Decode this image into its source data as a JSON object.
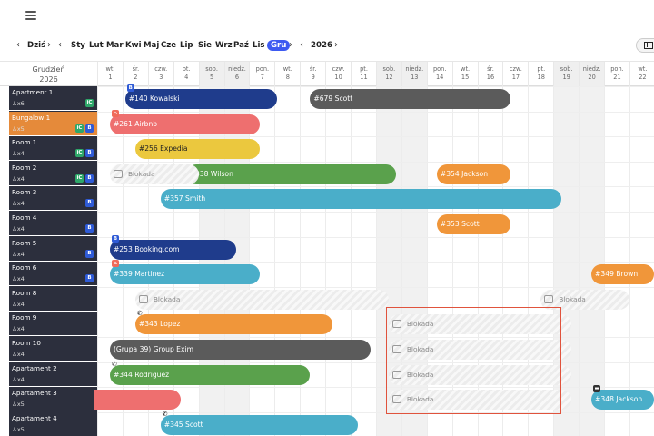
{
  "nav": {
    "today": "Dziś",
    "months": [
      "Sty",
      "Lut",
      "Mar",
      "Kwi",
      "Maj",
      "Cze",
      "Lip",
      "Sie",
      "Wrz",
      "Paź",
      "Lis",
      "Gru"
    ],
    "active_month": "Gru",
    "year": "2026"
  },
  "header": {
    "month_title": "Grudzień",
    "month_year": "2026",
    "days": [
      {
        "dow": "wt.",
        "num": "1"
      },
      {
        "dow": "śr.",
        "num": "2"
      },
      {
        "dow": "czw.",
        "num": "3"
      },
      {
        "dow": "pt.",
        "num": "4"
      },
      {
        "dow": "sob.",
        "num": "5"
      },
      {
        "dow": "niedz.",
        "num": "6"
      },
      {
        "dow": "pon.",
        "num": "7"
      },
      {
        "dow": "wt.",
        "num": "8"
      },
      {
        "dow": "śr.",
        "num": "9"
      },
      {
        "dow": "czw.",
        "num": "10"
      },
      {
        "dow": "pt.",
        "num": "11"
      },
      {
        "dow": "sob.",
        "num": "12"
      },
      {
        "dow": "niedz.",
        "num": "13"
      },
      {
        "dow": "pon.",
        "num": "14"
      },
      {
        "dow": "wt.",
        "num": "15"
      },
      {
        "dow": "śr.",
        "num": "16"
      },
      {
        "dow": "czw.",
        "num": "17"
      },
      {
        "dow": "pt.",
        "num": "18"
      },
      {
        "dow": "sob.",
        "num": "19"
      },
      {
        "dow": "niedz.",
        "num": "20"
      },
      {
        "dow": "pon.",
        "num": "21"
      },
      {
        "dow": "wt.",
        "num": "22"
      }
    ]
  },
  "rooms": [
    {
      "name": "Apartment 1",
      "cap": "x6",
      "badges": [
        "iC"
      ]
    },
    {
      "name": "Bungalow 1",
      "cap": "x5",
      "badges": [
        "iC",
        "B"
      ],
      "active": true
    },
    {
      "name": "Room 1",
      "cap": "x4",
      "badges": [
        "iC",
        "B"
      ]
    },
    {
      "name": "Room 2",
      "cap": "x4",
      "badges": [
        "iC",
        "B"
      ]
    },
    {
      "name": "Room 3",
      "cap": "x4",
      "badges": [
        "B"
      ]
    },
    {
      "name": "Room 4",
      "cap": "x4",
      "badges": [
        "B"
      ]
    },
    {
      "name": "Room 5",
      "cap": "x4",
      "badges": [
        "B"
      ]
    },
    {
      "name": "Room 6",
      "cap": "x4",
      "badges": [
        "B"
      ]
    },
    {
      "name": "Room 8",
      "cap": "x4",
      "badges": []
    },
    {
      "name": "Room 9",
      "cap": "x4",
      "badges": []
    },
    {
      "name": "Room 10",
      "cap": "x4",
      "badges": []
    },
    {
      "name": "Apartament 2",
      "cap": "x4",
      "badges": []
    },
    {
      "name": "Apartament 3",
      "cap": "x5",
      "badges": []
    },
    {
      "name": "Apartament 4",
      "cap": "x5",
      "badges": []
    }
  ],
  "bookings": [
    {
      "label": "#140 Kowalski",
      "color": "#1f3c8c",
      "row": 0
    },
    {
      "label": "#679 Scott",
      "color": "#5b5b5b",
      "row": 0
    },
    {
      "label": "#261 Airbnb",
      "color": "#ee6f6f",
      "row": 1
    },
    {
      "label": "#256 Expedia",
      "color": "#ebc83e",
      "row": 2
    },
    {
      "label": "#338 Wilson",
      "color": "#5aa14c",
      "row": 3
    },
    {
      "label": "#354 Jackson",
      "color": "#f0963a",
      "row": 3
    },
    {
      "label": "#357 Smith",
      "color": "#4aaec9",
      "row": 4
    },
    {
      "label": "#353 Scott",
      "color": "#f0963a",
      "row": 5
    },
    {
      "label": "#253 Booking.com",
      "color": "#1f3c8c",
      "row": 6
    },
    {
      "label": "#339 Martinez",
      "color": "#4aaec9",
      "row": 7
    },
    {
      "label": "#349 Brown",
      "color": "#f0963a",
      "row": 7
    },
    {
      "label": "#343 Lopez",
      "color": "#f0963a",
      "row": 9
    },
    {
      "label": "(Grupa 39) Group Exim",
      "color": "#5b5b5b",
      "row": 10
    },
    {
      "label": "#344 Rodriguez",
      "color": "#5aa14c",
      "row": 11
    },
    {
      "label": "",
      "color": "#ee6f6f",
      "row": 12
    },
    {
      "label": "#348 Jackson",
      "color": "#4aaec9",
      "row": 12
    },
    {
      "label": "#345 Scott",
      "color": "#4aaec9",
      "row": 13
    }
  ],
  "blocks_label": "Blokada",
  "colors": {
    "accent": "#3d5af1",
    "room_bg": "#2c2f3d",
    "room_active": "#e58a3a",
    "highlight": "#e0533d"
  },
  "icons": [
    "hamburger-icon",
    "chevron-left-icon",
    "chevron-right-icon",
    "grid-view-icon",
    "person-icon",
    "lock-icon",
    "phone-icon"
  ]
}
